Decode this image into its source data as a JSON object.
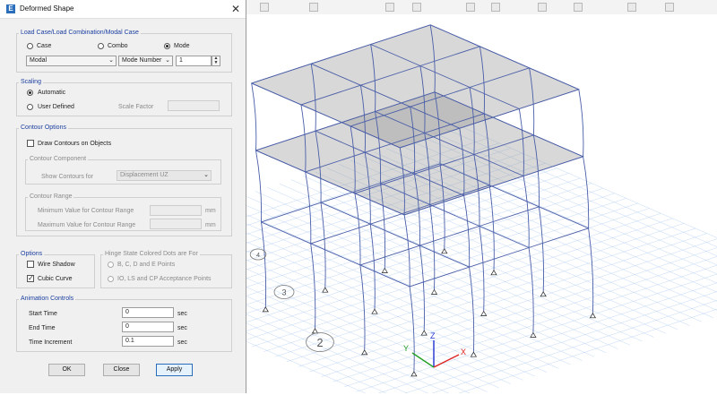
{
  "window": {
    "title": "Deformed Shape",
    "app_icon": "E",
    "close": "✕"
  },
  "load_case": {
    "group_label": "Load Case/Load Combination/Modal Case",
    "options": [
      {
        "label": "Case",
        "selected": false
      },
      {
        "label": "Combo",
        "selected": false
      },
      {
        "label": "Mode",
        "selected": true
      }
    ],
    "case_name": "Modal",
    "mode_type": "Mode Number",
    "mode_value": "1"
  },
  "scaling": {
    "group_label": "Scaling",
    "automatic_label": "Automatic",
    "user_defined_label": "User Defined",
    "scale_factor_label": "Scale Factor",
    "scale_factor_value": ""
  },
  "contour": {
    "group_label": "Contour Options",
    "draw_contours_label": "Draw Contours on Objects",
    "draw_contours_checked": false,
    "component_group_label": "Contour Component",
    "show_contours_for_label": "Show Contours for",
    "show_contours_value": "Displacement UZ",
    "range_group_label": "Contour Range",
    "min_label": "Minimum Value for Contour Range",
    "max_label": "Maximum Value for Contour Range",
    "min_unit": "mm",
    "max_unit": "mm"
  },
  "options": {
    "group_label": "Options",
    "wire_shadow_label": "Wire Shadow",
    "wire_shadow_checked": false,
    "cubic_curve_label": "Cubic Curve",
    "cubic_curve_checked": true
  },
  "hinge": {
    "group_label": "Hinge State Colored Dots are For",
    "option1": "B, C, D and E Points",
    "option2": "IO, LS and CP Acceptance Points"
  },
  "animation": {
    "group_label": "Animation Controls",
    "start_label": "Start Time",
    "start_value": "0",
    "end_label": "End Time",
    "end_value": "0",
    "increment_label": "Time Increment",
    "increment_value": "0.1",
    "unit": "sec"
  },
  "buttons": {
    "ok": "OK",
    "close": "Close",
    "apply": "Apply"
  },
  "viewport": {
    "grid_bubbles": [
      "2",
      "3",
      "4"
    ],
    "axes": {
      "x": "X",
      "y": "Y",
      "z": "Z"
    },
    "colors": {
      "frame": "#4a5ea8",
      "grid": "#a9c8f0",
      "slab": "#8f8f8f",
      "axis_x": "#e02020",
      "axis_y": "#22a022",
      "axis_z": "#2030d0"
    }
  }
}
